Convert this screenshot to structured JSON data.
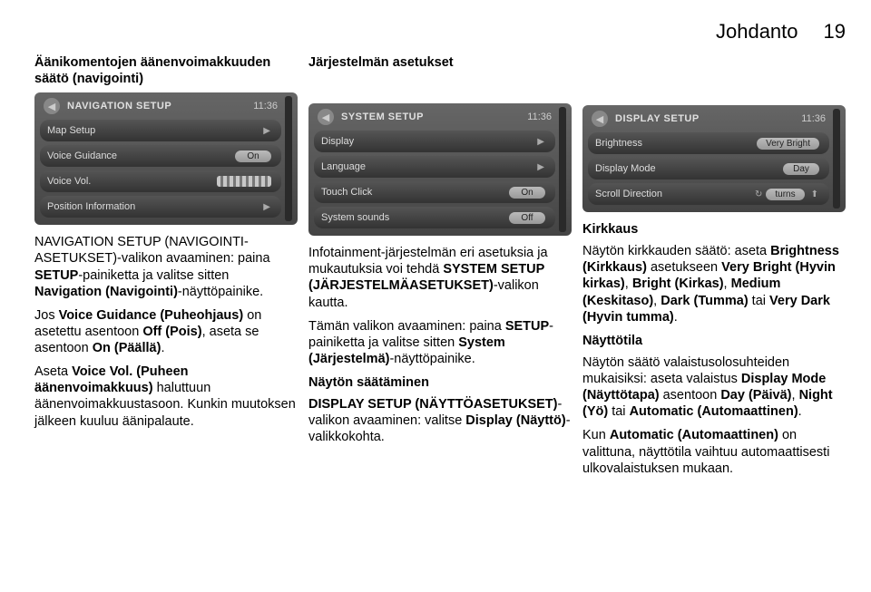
{
  "header": {
    "title": "Johdanto",
    "page": "19"
  },
  "col1": {
    "sub1": "Äänikomentojen äänenvoimakkuuden säätö (navigointi)",
    "screen": {
      "title": "NAVIGATION SETUP",
      "time": "11:36",
      "rows": [
        {
          "label": "Map Setup",
          "value": "",
          "type": "nav"
        },
        {
          "label": "Voice Guidance",
          "value": "On",
          "type": "pill"
        },
        {
          "label": "Voice Vol.",
          "value": "",
          "type": "slider"
        },
        {
          "label": "Position Information",
          "value": "",
          "type": "nav"
        }
      ]
    },
    "p1a": "NAVIGATION SETUP (NAVIGOINTI-ASETUKSET)-valikon avaaminen: paina ",
    "p1b": "SETUP",
    "p1c": "-painiketta ja valitse sitten ",
    "p1d": "Navigation (Navigointi)",
    "p1e": "-näyttöpainike.",
    "p2a": "Jos ",
    "p2b": "Voice Guidance (Puheohjaus)",
    "p2c": " on asetettu asentoon ",
    "p2d": "Off (Pois)",
    "p2e": ", aseta se asentoon ",
    "p2f": "On (Päällä)",
    "p2g": ".",
    "p3a": "Aseta ",
    "p3b": "Voice Vol. (Puheen äänenvoimakkuus)",
    "p3c": " haluttuun äänenvoimakkuustasoon. Kunkin muutoksen jälkeen kuuluu äänipalaute."
  },
  "col2": {
    "sub1": "Järjestelmän asetukset",
    "screen": {
      "title": "SYSTEM SETUP",
      "time": "11:36",
      "rows": [
        {
          "label": "Display",
          "value": "",
          "type": "nav"
        },
        {
          "label": "Language",
          "value": "",
          "type": "nav"
        },
        {
          "label": "Touch Click",
          "value": "On",
          "type": "pill"
        },
        {
          "label": "System sounds",
          "value": "Off",
          "type": "pill"
        }
      ]
    },
    "p1a": "Infotainment-järjestelmän eri asetuksia ja mukautuksia voi tehdä ",
    "p1b": "SYSTEM SETUP (JÄRJESTELMÄASETUKSET)",
    "p1c": "-valikon kautta.",
    "p2a": "Tämän valikon avaaminen: paina ",
    "p2b": "SETUP",
    "p2c": "-painiketta ja valitse sitten ",
    "p2d": "System (Järjestelmä)",
    "p2e": "-näyttöpainike.",
    "sub2": "Näytön säätäminen",
    "p3a": "DISPLAY SETUP (NÄYTTÖASETUKSET)",
    "p3b": "-valikon avaaminen: valitse ",
    "p3c": "Display (Näyttö)",
    "p3d": "-valikkokohta."
  },
  "col3": {
    "screen": {
      "title": "DISPLAY SETUP",
      "time": "11:36",
      "rows": [
        {
          "label": "Brightness",
          "value": "Very Bright",
          "type": "pill"
        },
        {
          "label": "Display Mode",
          "value": "Day",
          "type": "pill"
        },
        {
          "label": "Scroll Direction",
          "value": "turns",
          "type": "scroll"
        }
      ]
    },
    "sub1": "Kirkkaus",
    "p1a": "Näytön kirkkauden säätö: aseta ",
    "p1b": "Brightness (Kirkkaus)",
    "p1c": " asetukseen ",
    "p1d": "Very Bright (Hyvin kirkas)",
    "p1e": ", ",
    "p1f": "Bright (Kirkas)",
    "p1g": ", ",
    "p1h": "Medium (Keskitaso)",
    "p1i": ", ",
    "p1j": "Dark (Tumma)",
    "p1k": " tai ",
    "p1l": "Very Dark (Hyvin tumma)",
    "p1m": ".",
    "sub2": "Näyttötila",
    "p2a": "Näytön säätö valaistusolosuhteiden mukaisiksi: aseta valaistus ",
    "p2b": "Display Mode (Näyttötapa)",
    "p2c": " asentoon ",
    "p2d": "Day (Päivä)",
    "p2e": ", ",
    "p2f": "Night (Yö)",
    "p2g": " tai ",
    "p2h": "Automatic (Automaattinen)",
    "p2i": ".",
    "p3a": "Kun ",
    "p3b": "Automatic (Automaattinen)",
    "p3c": " on valittuna, näyttötila vaihtuu automaattisesti ulkovalaistuksen mukaan."
  }
}
